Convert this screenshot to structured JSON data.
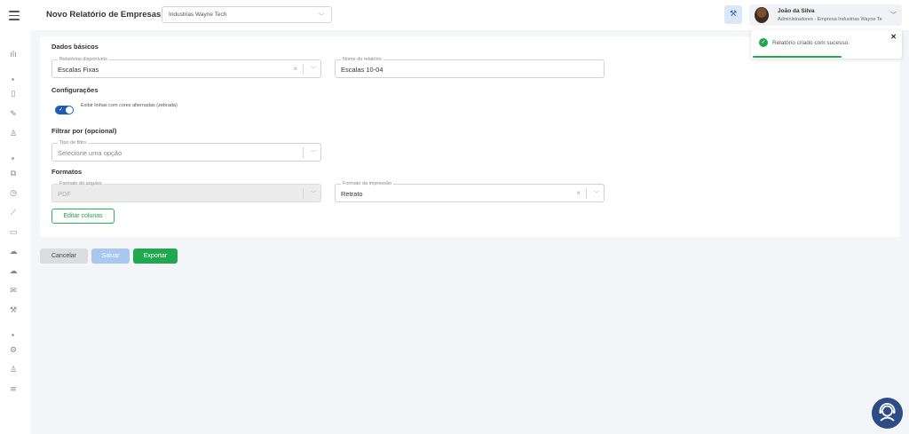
{
  "header": {
    "title": "Novo Relatório de Empresas",
    "company_select": "Industrias Wayne Tech",
    "user_name": "João da Silva",
    "user_role": "Administradores - Empresa Industrias Wayne Tech"
  },
  "sections": {
    "basic": "Dados básicos",
    "config": "Configurações",
    "filter": "Filtrar por (opcional)",
    "formats": "Formatos"
  },
  "fields": {
    "available_reports": {
      "label": "Relatórios disponíveis",
      "value": "Escalas Fixas"
    },
    "report_name": {
      "label": "Nome do relatório",
      "value": "Escalas 10-04"
    },
    "filter_type": {
      "label": "Tipo de filtro",
      "placeholder": "Selecione uma opção"
    },
    "file_format": {
      "label": "Formato do arquivo",
      "value": "PDF"
    },
    "print_format": {
      "label": "Formato da impressão",
      "value": "Retrato"
    }
  },
  "toggle": {
    "label": "Exibir linhas com cores alternadas (zebrada)",
    "checked": true
  },
  "buttons": {
    "edit_columns": "Editar colunas",
    "cancel": "Cancelar",
    "save": "Salvar",
    "export": "Exportar"
  },
  "toast": {
    "message": "Relatório criado com sucesso.",
    "progress": 0.6
  },
  "colors": {
    "primary": "#1e5bb5",
    "success": "#1fa84f",
    "save_disabled": "#a8c8f0",
    "help_button": "#2d4c86"
  }
}
